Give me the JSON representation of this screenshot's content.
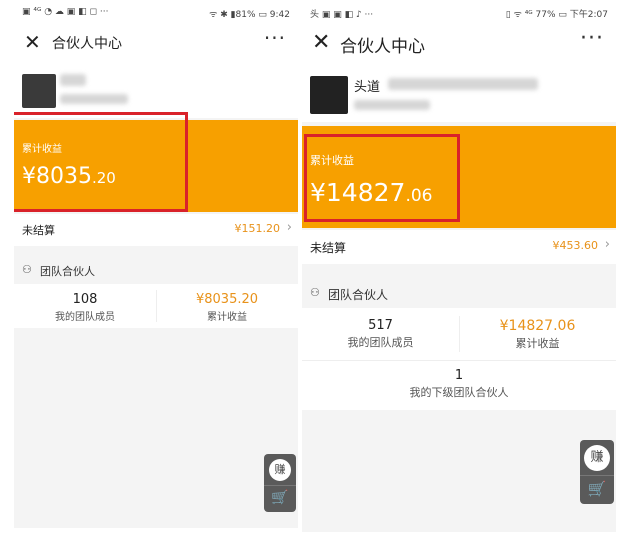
{
  "left": {
    "status": {
      "left_icons": "▣ ⁴ᴳ ◔ ☁ ▣ ◧ ◻ ···",
      "right": "ᯤ ✱ ▮81% ▭ 9:42"
    },
    "nav": {
      "title": "合伙人中心",
      "close": "✕",
      "more": "···"
    },
    "earnings": {
      "label": "累计收益",
      "currency": "¥",
      "integer": "8035",
      "decimal": ".20"
    },
    "unsettled": {
      "label": "未结算",
      "value": "¥151.20"
    },
    "team": {
      "title": "团队合伙人",
      "members_count": "108",
      "members_label": "我的团队成员",
      "earnings_value": "¥8035.20",
      "earnings_label": "累计收益"
    },
    "float": {
      "earn": "赚",
      "cart": "🛒"
    }
  },
  "right": {
    "status": {
      "left_icons": "头 ▣ ▣ ◧ ♪ ···",
      "right": "▯ ᯤ ⁴ᴳ 77% ▭ 下午2:07"
    },
    "nav": {
      "title": "合伙人中心",
      "close": "✕",
      "more": "···"
    },
    "user": {
      "name": "头道"
    },
    "earnings": {
      "label": "累计收益",
      "currency": "¥",
      "integer": "14827",
      "decimal": ".06"
    },
    "unsettled": {
      "label": "未结算",
      "value": "¥453.60"
    },
    "team": {
      "title": "团队合伙人",
      "members_count": "517",
      "members_label": "我的团队成员",
      "earnings_value": "¥14827.06",
      "earnings_label": "累计收益",
      "sub_count": "1",
      "sub_label": "我的下级团队合伙人"
    },
    "float": {
      "earn": "赚",
      "cart": "🛒"
    }
  },
  "colors": {
    "accent_orange": "#f7a000",
    "value_orange": "#e8921a",
    "highlight_red": "#d9222a"
  }
}
